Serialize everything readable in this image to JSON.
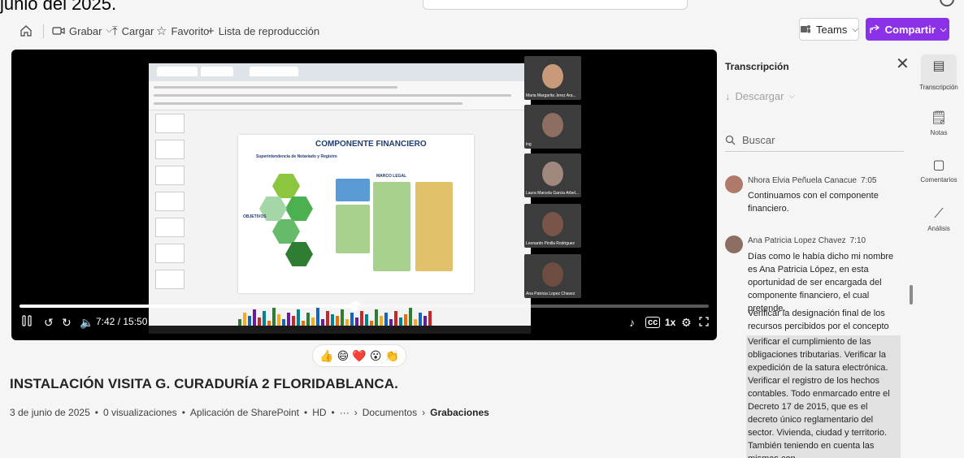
{
  "top_fragment": "junio del 2025.",
  "toolbar": {
    "home_icon": "home-icon",
    "record_label": "Grabar",
    "upload_label": "Cargar",
    "favorite_label": "Favorito",
    "playlist_label": "Lista de reproducción",
    "teams_label": "Teams",
    "share_label": "Compartir",
    "share_color": "#8b31e8"
  },
  "player": {
    "current_time": "7:42 / 15:50",
    "progress_fraction": 0.487,
    "speed_label": "1x",
    "slide": {
      "title": "COMPONENTE FINANCIERO",
      "org": "Superintendencia de Notariado y Registro",
      "objectives_label": "OBJETIVOS",
      "legal_label": "MARCO LEGAL"
    },
    "participants": [
      {
        "name": "Maria Margarita Jerez Ara..."
      },
      {
        "name": "ing"
      },
      {
        "name": "Laura Marcela Garcia Arbel..."
      },
      {
        "name": "Leonardo Pinilla Rodriguez"
      },
      {
        "name": "Ana Patricia Lopez Chavez"
      }
    ]
  },
  "reactions": [
    "👍",
    "😄",
    "❤️",
    "😮",
    "👏"
  ],
  "video": {
    "title": "INSTALACIÓN VISITA G. CURADURÍA 2 FLORIDABLANCA.",
    "date": "3 de junio de 2025",
    "views": "0 visualizaciones",
    "app": "Aplicación de SharePoint",
    "quality": "HD",
    "more": "···",
    "crumb1": "Documentos",
    "crumb2": "Grabaciones"
  },
  "transcript": {
    "title": "Transcripción",
    "download_label": "Descargar",
    "search_placeholder": "Buscar",
    "entries": [
      {
        "speaker": "Nhora Elvia Peñuela Canacue",
        "time": "7:05",
        "text": "Continuamos con el componente financiero."
      },
      {
        "speaker": "Ana Patricia Lopez Chavez",
        "time": "7:10",
        "text1": "Días como le había dicho mi nombre es Ana Patricia López, en esta oportunidad de ser encargada del componente financiero, el cual pretende.",
        "text2": "Verificar la designación final de los recursos percibidos por el concepto de despensas.",
        "text3": "Verificar el cumplimiento de las obligaciones tributarias. Verificar la expedición de la satura electrónica. Verificar el registro de los hechos contables. Todo enmarcado entre el Decreto 17 de 2015, que es el decreto único reglamentario del sector. Vivienda, ciudad y territorio. También teniendo en cuenta las mismas con."
      }
    ]
  },
  "rail": {
    "transcript": "Transcripción",
    "notes": "Notas",
    "comments": "Comentarios",
    "analytics": "Análisis"
  }
}
